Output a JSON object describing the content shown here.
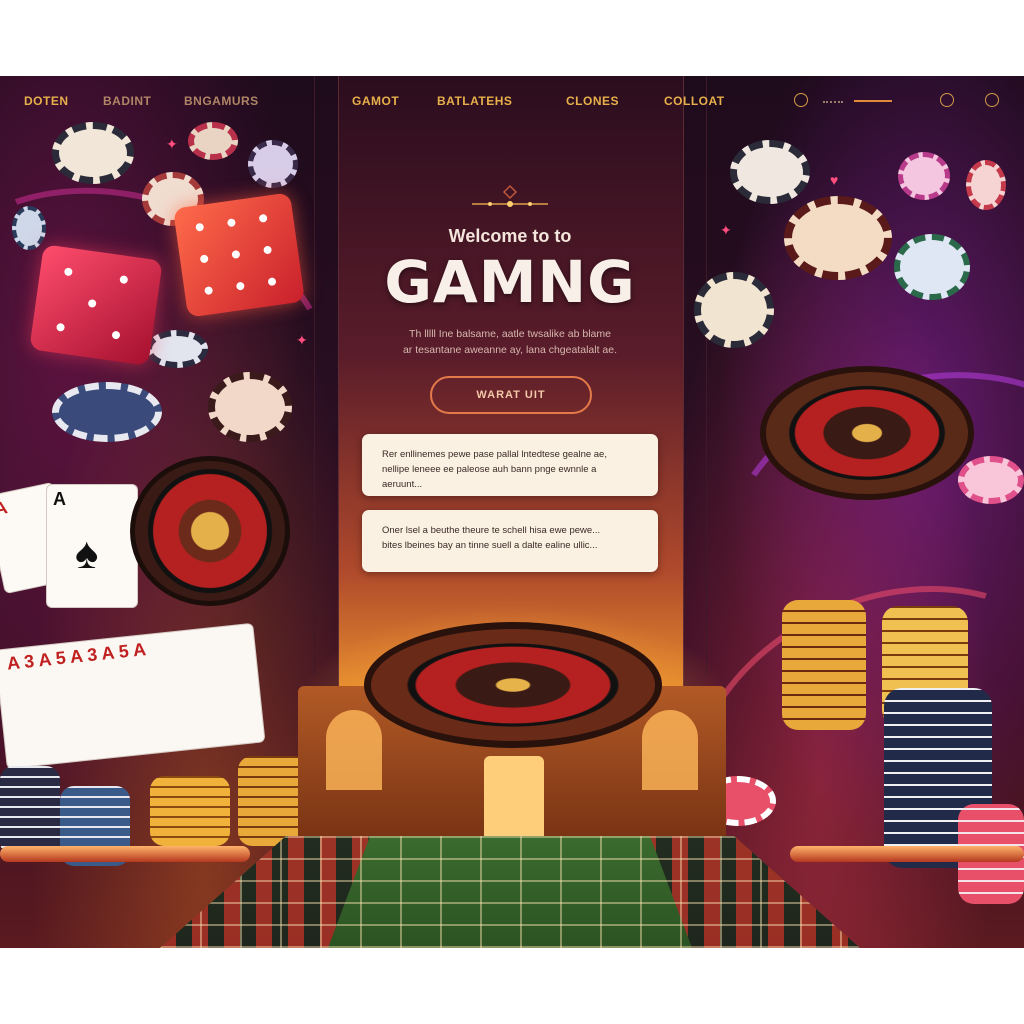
{
  "nav": {
    "left_links": [
      "DOTEN",
      "BADINT",
      "BNGAMURS"
    ],
    "center_links": [
      "GAMOT",
      "BATLATEHS",
      "CLONES",
      "COLLOAT"
    ]
  },
  "hero": {
    "welcome": "Welcome to to",
    "title": "GAMNG",
    "subtitle_line1": "Th lllll Ine balsame, aatle twsalike ab blame",
    "subtitle_line2": "ar tesantane aweanne ay, lana chgeatalalt ae.",
    "cta_label": "WARAT UIT"
  },
  "cards": [
    {
      "line1": "Rer enllinemes pewe pase pallal lntedtese gealne ae,",
      "line2": "nellipe leneee ee paleose auh bann pnge ewnnle a aeruunt..."
    },
    {
      "line1": "Oner lsel a beuthe theure te schell hisa ewe pewe...",
      "line2": "bites lbeines bay an tinne suell a dalte ealine ullic..."
    }
  ],
  "colors": {
    "nav_gold": "#e7b04b",
    "cta_border": "#e47a4a",
    "card_bg": "#fbf1e2",
    "bg_dark": "#1e0b1c"
  },
  "icons": [
    "power-icon",
    "settings-icon",
    "menu-dots-icon",
    "spade-icon",
    "diamond-ornament-icon"
  ]
}
